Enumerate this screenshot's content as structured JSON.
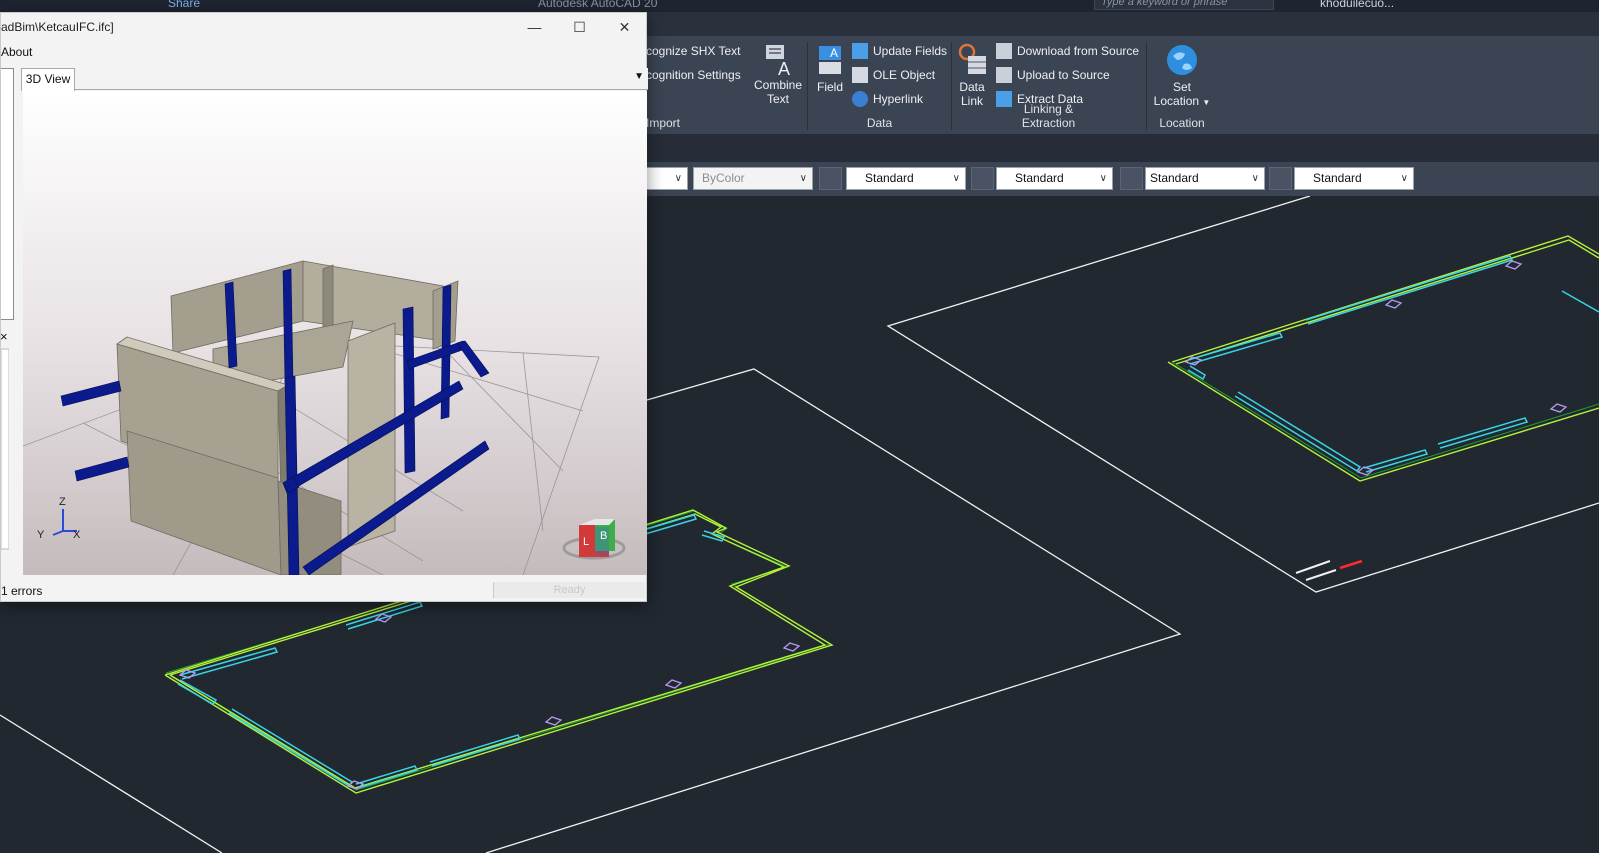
{
  "topbar": {
    "app_title": "Autodesk AutoCAD 20",
    "share_label": "Share",
    "search_placeholder": "Type a keyword or phrase",
    "user_name": "khoduilecuo..."
  },
  "ribbon": {
    "import_panel": {
      "label": "Import",
      "recognize_shx": "cognize SHX Text",
      "recognition_settings": "cognition Settings",
      "combine_text": [
        "Combine",
        "Text"
      ]
    },
    "data_panel": {
      "label": "Data",
      "field": "Field",
      "update_fields": "Update Fields",
      "ole_object": "OLE Object",
      "hyperlink": "Hyperlink"
    },
    "linking_panel": {
      "label": "Linking & Extraction",
      "data_link": [
        "Data",
        "Link"
      ],
      "download_from_source": "Download from Source",
      "upload_to_source": "Upload to Source",
      "extract_data": "Extract  Data"
    },
    "location_panel": {
      "label": "Location",
      "set_location": [
        "Set",
        "Location"
      ]
    }
  },
  "properties": {
    "color": "ByColor",
    "text_style": "Standard",
    "dim_style": "Standard",
    "table_style": "Standard",
    "mleader_style": "Standard"
  },
  "viewer": {
    "title": "adBim\\KetcauIFC.ifc]",
    "menu_about": "About",
    "tab_3d_view": "3D View",
    "axis_labels": {
      "z": "Z",
      "y": "Y",
      "x": "X"
    },
    "cube_labels": {
      "left": "L",
      "back": "B"
    },
    "status_errors": "1 errors",
    "status_ready": "Ready"
  },
  "colors": {
    "ribbon_bg": "#3b4453",
    "drawing_bg": "#212830",
    "wall_green": "#b6f23a",
    "beam_cyan": "#38d4e6",
    "column_magenta": "#b79cf2",
    "ifc_column_blue": "#0b1a8c",
    "ifc_wall": "#9f9a8a"
  }
}
